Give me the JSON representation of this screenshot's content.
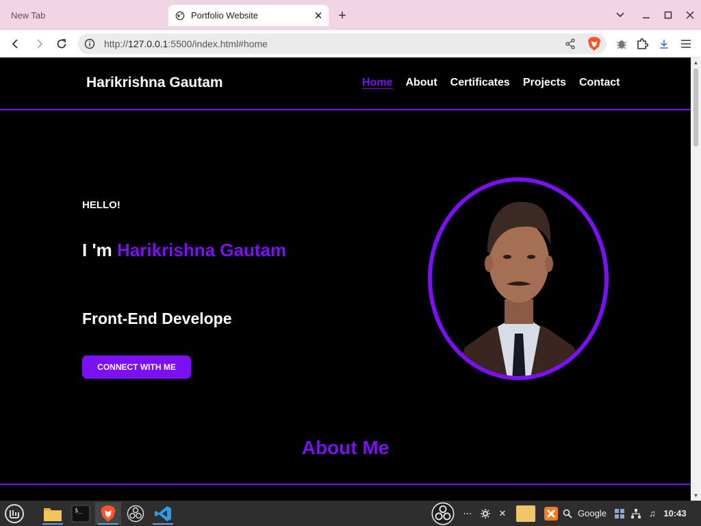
{
  "browser": {
    "tabs": [
      {
        "title": "New Tab",
        "active": false
      },
      {
        "title": "Portfolio Website",
        "active": true
      }
    ],
    "url": {
      "scheme": "http://",
      "host": "127.0.0.1",
      "rest": ":5500/index.html#home"
    }
  },
  "site": {
    "logo": "Harikrishna Gautam",
    "nav": [
      "Home",
      "About",
      "Certificates",
      "Projects",
      "Contact"
    ],
    "active_nav": "Home",
    "hero": {
      "greeting": "HELLO!",
      "intro_prefix": "I 'm ",
      "name": "Harikrishna Gautam",
      "role": "Front-End Develope",
      "cta": "CONNECT WITH ME"
    },
    "about_title": "About Me",
    "accent_color": "#7c10f5"
  },
  "taskbar": {
    "search_label": "Google",
    "clock": "10:43"
  },
  "icons": {
    "back": "back-arrow-icon",
    "forward": "forward-arrow-icon",
    "reload": "reload-icon",
    "info": "site-info-icon",
    "share": "share-icon",
    "brave": "brave-shield-icon",
    "bug": "bug-icon",
    "extensions": "puzzle-icon",
    "downloads": "download-icon",
    "menu": "hamburger-icon"
  }
}
